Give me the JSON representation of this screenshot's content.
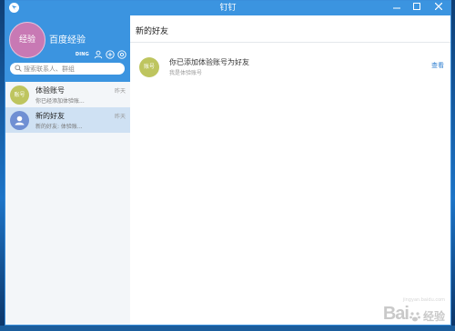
{
  "window": {
    "title": "钉钉"
  },
  "profile": {
    "avatar_text": "经验",
    "name": "百度经验",
    "ding_label": "DING",
    "avatar_color": "#c879b4"
  },
  "search": {
    "placeholder": "搜索联系人、群组"
  },
  "conversations": [
    {
      "avatar_text": "账号",
      "name": "体验账号",
      "preview": "你已经添加体验账...",
      "time": "昨天",
      "avatar_color": "#bec55f"
    },
    {
      "avatar_text": "",
      "name": "新的好友",
      "preview": "新的好友: 体验账...",
      "time": "昨天",
      "avatar_color": "#6f8fd3"
    }
  ],
  "main": {
    "title": "新的好友",
    "friend": {
      "avatar_text": "账号",
      "title": "你已添加体验账号为好友",
      "subtitle": "我是体验账号",
      "action": "查看"
    }
  },
  "watermark": {
    "brand": "Bai",
    "cn": "经验",
    "url": "jingyan.baidu.com"
  },
  "colors": {
    "accent": "#3b94e0",
    "selected": "#cfe1f3",
    "link": "#2f7fd1"
  }
}
